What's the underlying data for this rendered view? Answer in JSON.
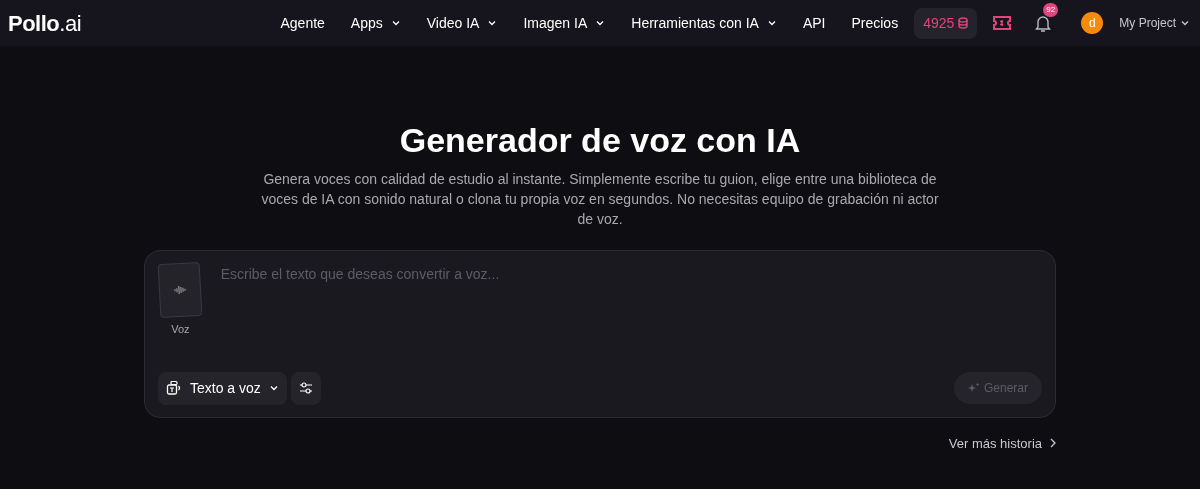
{
  "header": {
    "logo": "**Pollo**.ai",
    "nav": [
      {
        "label": "Agente",
        "has_menu": false
      },
      {
        "label": "Apps",
        "has_menu": true
      },
      {
        "label": "Video IA",
        "has_menu": true
      },
      {
        "label": "Imagen IA",
        "has_menu": true
      },
      {
        "label": "Herramientas con IA",
        "has_menu": true
      },
      {
        "label": "API",
        "has_menu": false
      },
      {
        "label": "Precios",
        "has_menu": false
      }
    ],
    "credits": "4925",
    "notifications": "92",
    "avatar": "d",
    "project": "My Project"
  },
  "hero": {
    "title": "Generador de voz con IA",
    "subtitle": "Genera voces con calidad de estudio al instante. Simplemente escribe tu guion, elige entre una biblioteca de voces de IA con sonido natural o clona tu propia voz en segundos. No necesitas equipo de grabación ni actor de voz."
  },
  "editor": {
    "voice_label": "Voz",
    "placeholder": "Escribe el texto que deseas convertir a voz...",
    "mode": "Texto a voz",
    "generate": {
      "label": "Generar",
      "disabled": true
    }
  },
  "history_link": "Ver más historia"
}
